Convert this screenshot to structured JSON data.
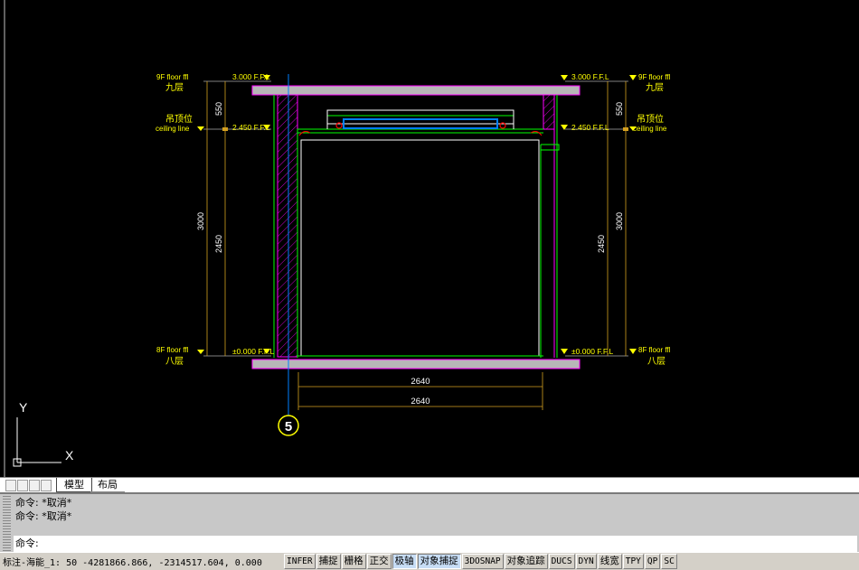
{
  "drawing": {
    "level_labels": {
      "floor9_en": "9F floor ffl",
      "floor9_cn": "九层",
      "ceiling_cn": "吊顶位",
      "ceiling_en": "ceiling line",
      "floor8_en": "8F floor ffl",
      "floor8_cn": "八层"
    },
    "elevations": {
      "top": "3.000 F.F.L",
      "ceiling": "2.450 F.F.L",
      "floor": "±0.000 F.F.L"
    },
    "dims": {
      "d550": "550",
      "d3000": "3000",
      "d2450": "2450",
      "d2640_a": "2640",
      "d2640_b": "2640"
    },
    "grid_bubble": "5",
    "ucs": {
      "y": "Y",
      "x": "X"
    }
  },
  "tabs": {
    "model": "模型",
    "layout": "布局"
  },
  "command": {
    "history": [
      "命令: *取消*",
      "命令: *取消*"
    ],
    "prompt": "命令:"
  },
  "status": {
    "coords": "标注-海能_1: 50  -4281866.866, -2314517.604, 0.000",
    "buttons": [
      {
        "label": "INFER",
        "on": false,
        "latin": true
      },
      {
        "label": "捕捉",
        "on": false,
        "latin": false
      },
      {
        "label": "栅格",
        "on": false,
        "latin": false
      },
      {
        "label": "正交",
        "on": false,
        "latin": false
      },
      {
        "label": "极轴",
        "on": true,
        "latin": false
      },
      {
        "label": "对象捕捉",
        "on": true,
        "latin": false
      },
      {
        "label": "3DOSNAP",
        "on": false,
        "latin": true
      },
      {
        "label": "对象追踪",
        "on": false,
        "latin": false
      },
      {
        "label": "DUCS",
        "on": false,
        "latin": true
      },
      {
        "label": "DYN",
        "on": false,
        "latin": true
      },
      {
        "label": "线宽",
        "on": false,
        "latin": false
      },
      {
        "label": "TPY",
        "on": false,
        "latin": true
      },
      {
        "label": "QP",
        "on": false,
        "latin": true
      },
      {
        "label": "SC",
        "on": false,
        "latin": true
      }
    ]
  },
  "colors": {
    "yellow": "#ffff00",
    "green": "#00ff00",
    "white": "#ffffff",
    "magenta": "#ff00ff",
    "slab": "#b7b7b7",
    "cyan_blue": "#0080ff",
    "red": "#ff0000",
    "dim": "#d4a020"
  }
}
